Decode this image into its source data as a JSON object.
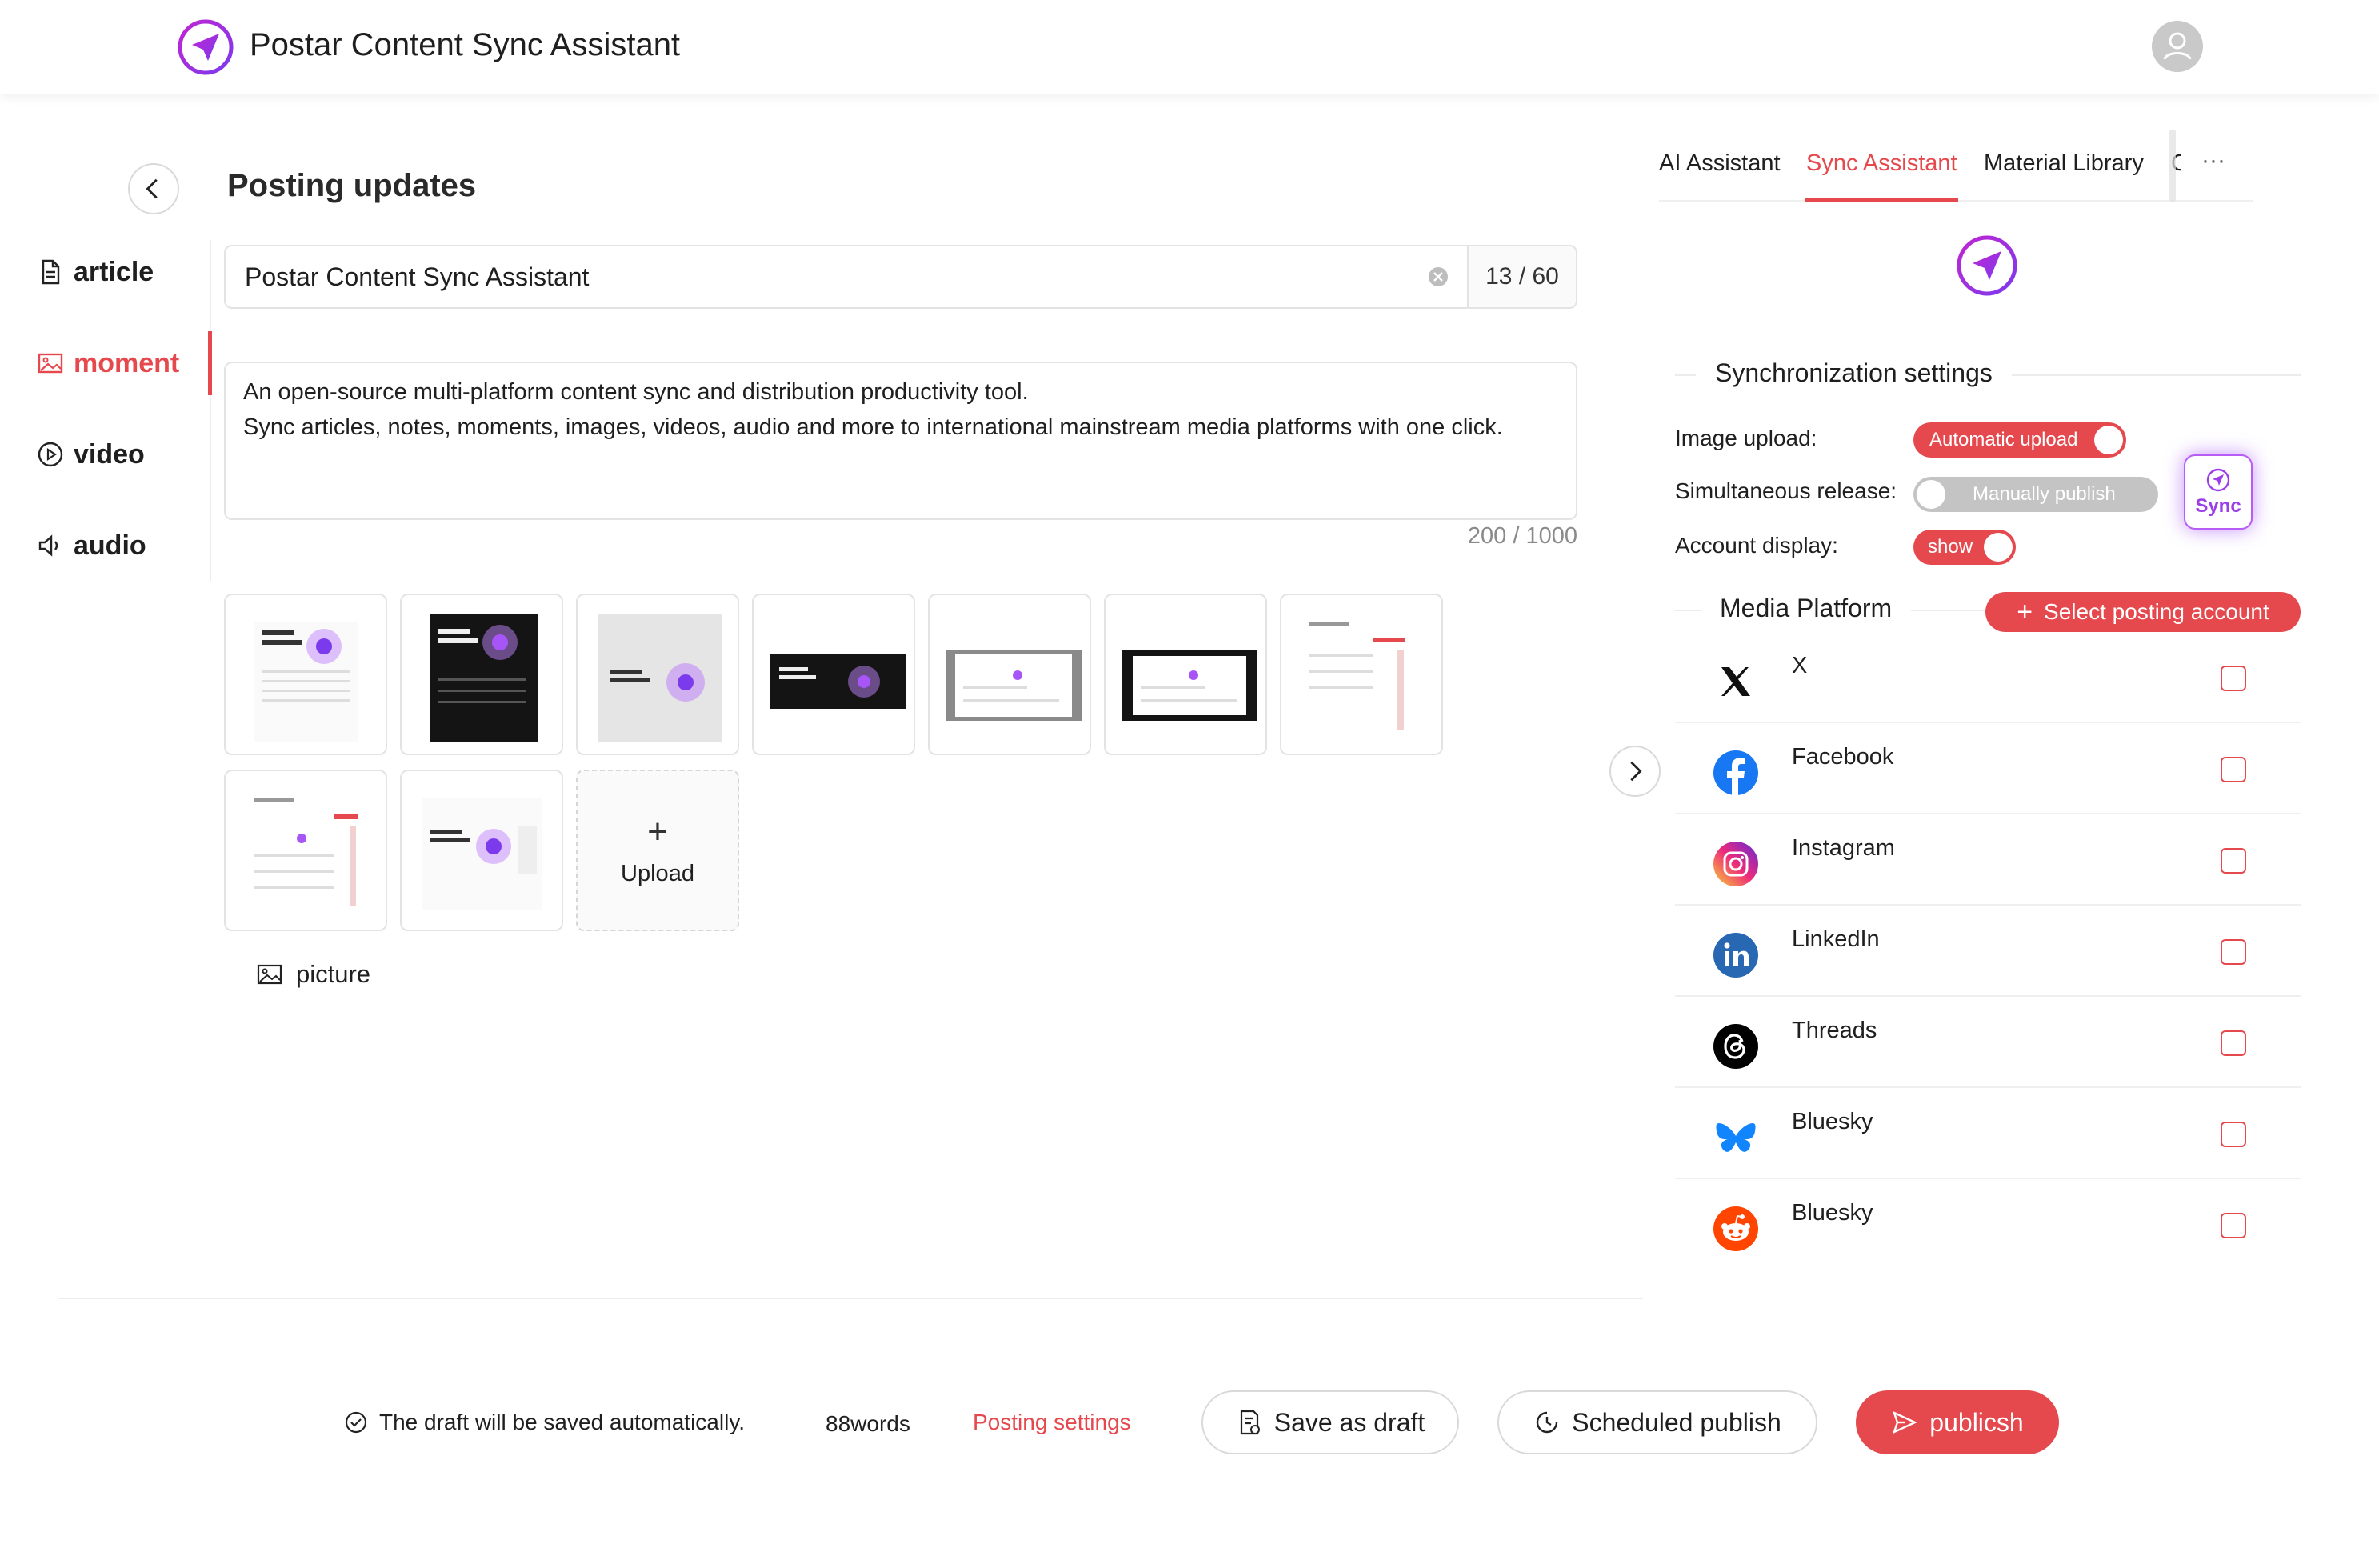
{
  "app": {
    "title": "Postar Content Sync Assistant"
  },
  "page": {
    "title": "Posting updates"
  },
  "nav": {
    "items": [
      {
        "label": "article",
        "icon": "document-icon"
      },
      {
        "label": "moment",
        "icon": "image-icon",
        "active": true
      },
      {
        "label": "video",
        "icon": "play-circle-icon"
      },
      {
        "label": "audio",
        "icon": "speaker-icon"
      }
    ]
  },
  "editor": {
    "title_value": "Postar Content Sync Assistant",
    "title_count": "13 / 60",
    "content_line1": "An open-source multi-platform content sync and distribution productivity tool.",
    "content_line2": "Sync articles, notes, moments, images, videos, audio and more to international mainstream media platforms with one click.",
    "content_count": "200 / 1000",
    "upload_label": "Upload",
    "picture_label": "picture"
  },
  "footer": {
    "autosave_note": "The draft will be saved automatically.",
    "word_count": "88words",
    "posting_settings": "Posting settings",
    "save_draft": "Save as draft",
    "scheduled": "Scheduled publish",
    "publish": "publicsh"
  },
  "panel": {
    "tabs": [
      {
        "label": "AI Assistant"
      },
      {
        "label": "Sync Assistant",
        "active": true
      },
      {
        "label": "Material Library"
      },
      {
        "label": "C"
      }
    ],
    "more": "···",
    "sync_settings_title": "Synchronization settings",
    "image_upload_label": "Image upload:",
    "image_upload_value": "Automatic upload",
    "simultaneous_label": "Simultaneous release:",
    "simultaneous_value": "Manually publish",
    "account_display_label": "Account display:",
    "account_display_value": "show",
    "sync_button": "Sync",
    "media_platform_title": "Media Platform",
    "select_account_button": "Select posting account",
    "platforms": [
      {
        "name": "X",
        "icon": "x-icon"
      },
      {
        "name": "Facebook",
        "icon": "facebook-icon"
      },
      {
        "name": "Instagram",
        "icon": "instagram-icon"
      },
      {
        "name": "LinkedIn",
        "icon": "linkedin-icon"
      },
      {
        "name": "Threads",
        "icon": "threads-icon"
      },
      {
        "name": "Bluesky",
        "icon": "bluesky-icon"
      },
      {
        "name": "Bluesky",
        "icon": "reddit-icon"
      }
    ]
  },
  "colors": {
    "accent": "#e5484d",
    "brand_purple": "#a855f7"
  }
}
